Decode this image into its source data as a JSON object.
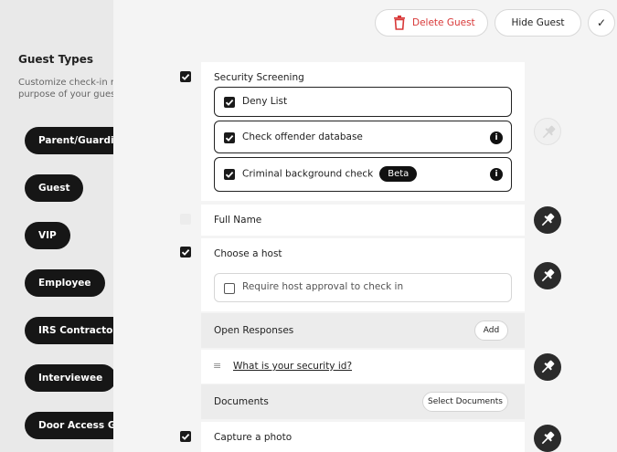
{
  "sidebar": {
    "title": "Guest Types",
    "description_line1": "Customize check-in re",
    "description_line2": "purpose of your guest",
    "items": [
      "Parent/Guardian",
      "Guest",
      "VIP",
      "Employee",
      "IRS Contractor",
      "Interviewee",
      "Door Access Gue"
    ]
  },
  "toolbar": {
    "delete_label": "Delete Guest",
    "hide_label": "Hide Guest",
    "confirm_icon": "check-icon",
    "delete_color": "#d83838"
  },
  "security": {
    "title": "Security Screening",
    "deny_list": "Deny List",
    "offender": "Check offender database",
    "background": "Criminal background check",
    "beta": "Beta",
    "info_glyph": "i"
  },
  "fields": {
    "full_name": "Full Name",
    "host": "Choose a host",
    "host_approval": "Require host approval to check in",
    "open_responses": "Open Responses",
    "add_label": "Add",
    "question": "What is your security id?",
    "handle_glyph": "≡",
    "documents": "Documents",
    "select_documents": "Select Documents",
    "photo": "Capture a photo"
  }
}
